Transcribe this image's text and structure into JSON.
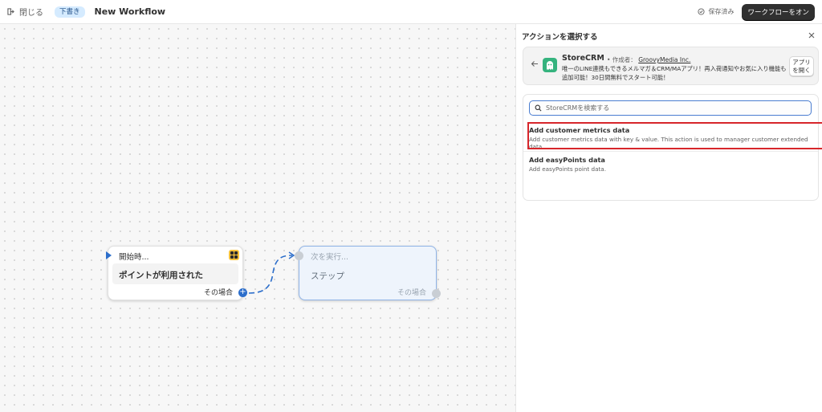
{
  "topbar": {
    "close_label": "閉じる",
    "draft_badge": "下書き",
    "title": "New Workflow",
    "saved_label": "保存済み",
    "turn_on_label": "ワークフローをオン"
  },
  "canvas": {
    "trigger": {
      "header": "開始時...",
      "event": "ポイントが利用された",
      "condition": "その場合"
    },
    "next_step": {
      "header": "次を実行...",
      "label": "ステップ",
      "condition": "その場合"
    }
  },
  "panel": {
    "title": "アクションを選択する",
    "app": {
      "name": "StoreCRM",
      "by_prefix": "• 作成者：",
      "publisher": "GroovyMedia Inc.",
      "description": "唯一のLINE連携もできるメルマガ＆CRM/MAアプリ！再入荷通知やお気に入り機能も追加可能！30日間無料でスタート可能！",
      "open_button": "アプリを開く"
    },
    "search": {
      "placeholder": "StoreCRMを検索する"
    },
    "actions": [
      {
        "name": "Add customer metrics data",
        "description": "Add customer metrics data with key & value. This action is used to manager customer extended data."
      },
      {
        "name": "Add easyPoints data",
        "description": "Add easyPoints point data."
      }
    ]
  },
  "colors": {
    "accent": "#2c6ecb",
    "highlight": "#d7262b",
    "app_logo": "#35b37e",
    "primary_button": "#303030"
  }
}
